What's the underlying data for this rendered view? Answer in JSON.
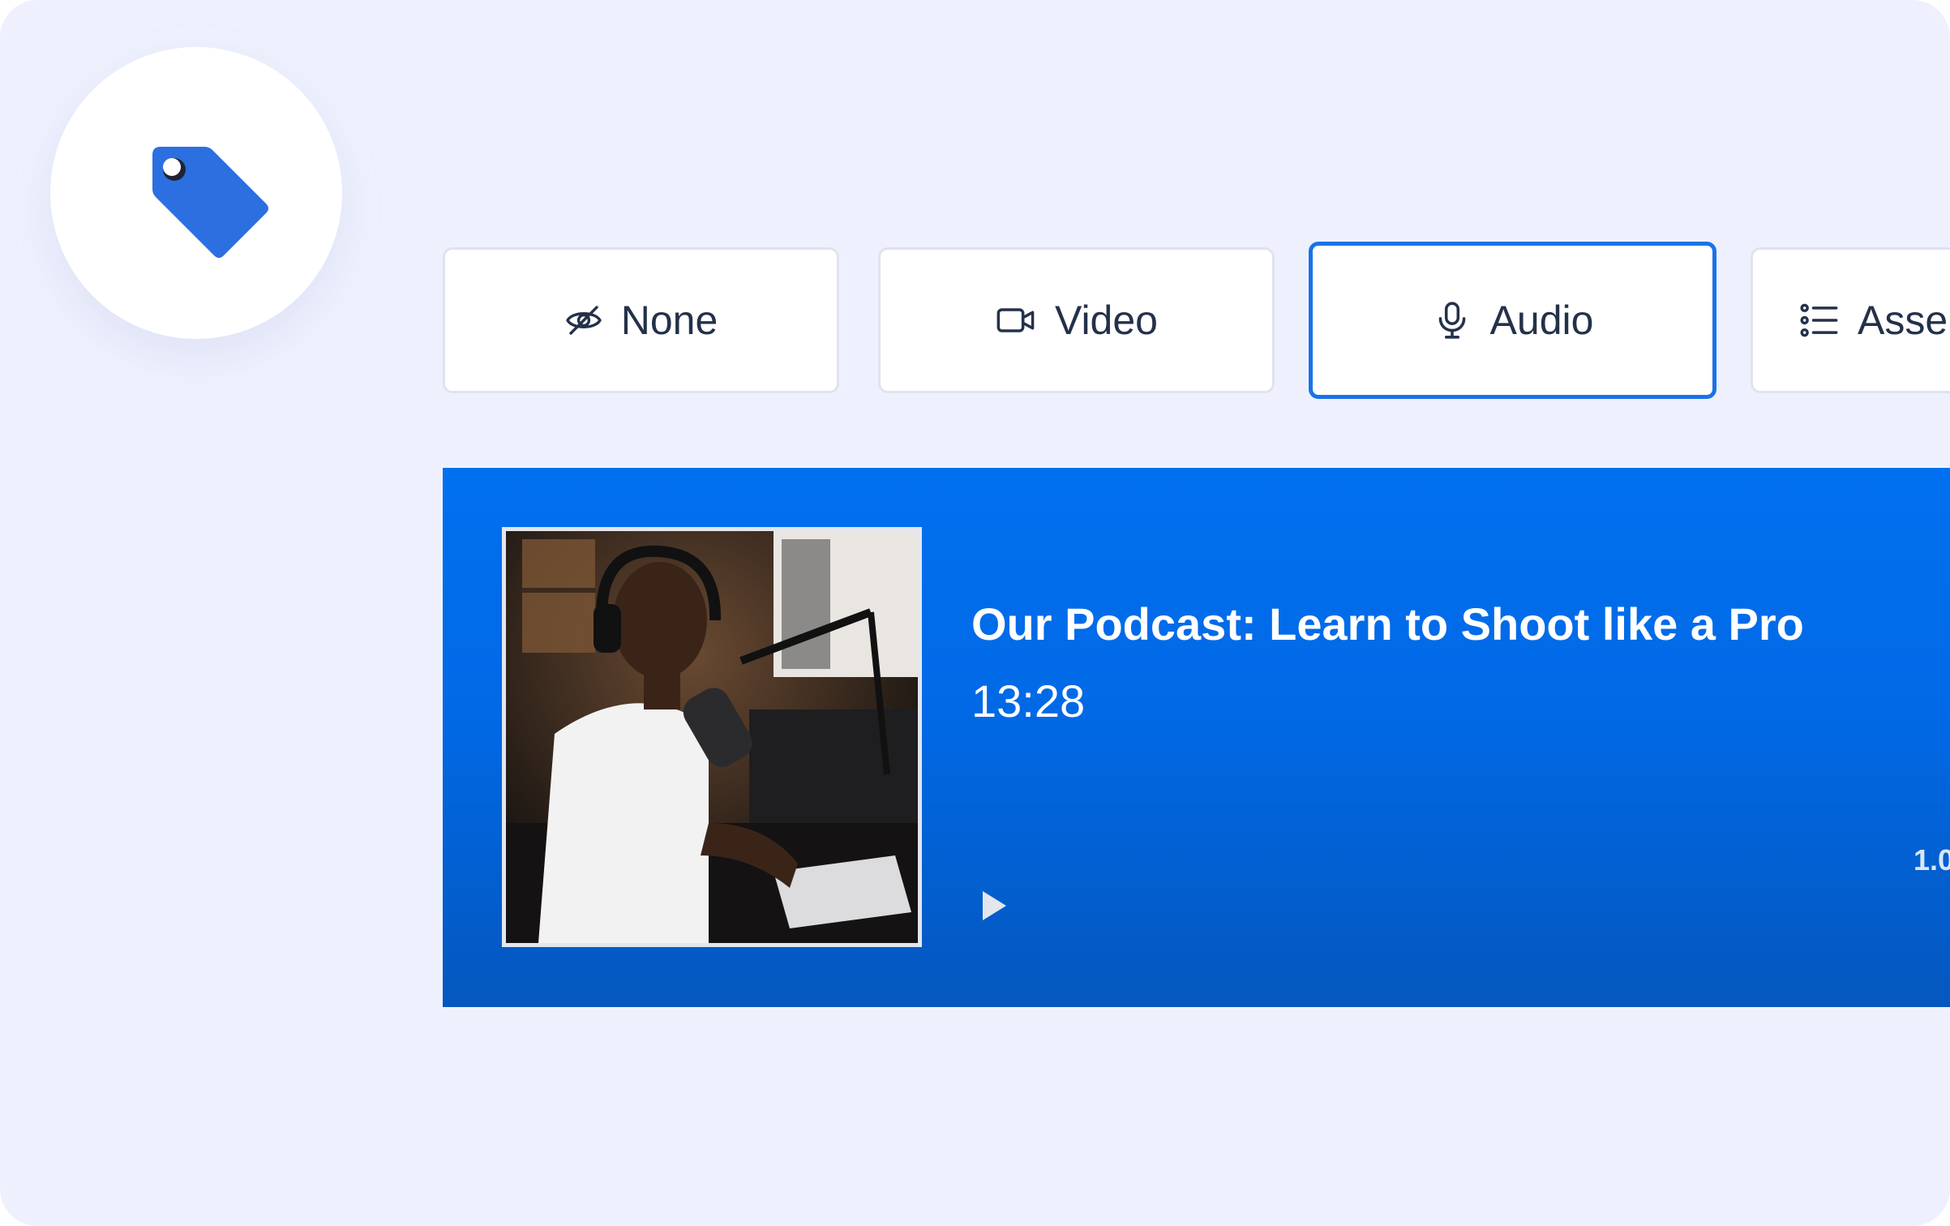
{
  "tabs": [
    {
      "id": "none",
      "label": "None",
      "icon": "eye-off-icon"
    },
    {
      "id": "video",
      "label": "Video",
      "icon": "video-camera-icon"
    },
    {
      "id": "audio",
      "label": "Audio",
      "icon": "microphone-icon",
      "active": true
    },
    {
      "id": "assets",
      "label": "Asse",
      "icon": "list-icon"
    }
  ],
  "feature_icon": "tag-icon",
  "player": {
    "title": "Our Podcast: Learn to Shoot like a Pro",
    "duration": "13:28",
    "speed": "1.0",
    "play_icon": "play-icon",
    "thumbnail": "podcast-host-photo"
  },
  "colors": {
    "background": "#eef1fd",
    "accent": "#1a73e8",
    "player_top": "#0170ef",
    "player_bottom": "#0457be",
    "tag": "#2c6fe0"
  }
}
